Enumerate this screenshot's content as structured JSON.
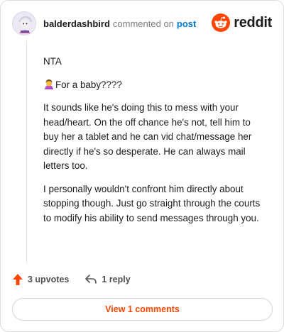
{
  "header": {
    "username": "balderdashbird",
    "action": "commented on",
    "post_link": "post",
    "brand": "reddit"
  },
  "comment": {
    "paragraphs": [
      "NTA",
      "For a baby????",
      "It sounds like he's doing this to mess with your head/heart. On the off chance he's not, tell him to buy her a tablet and he can vid chat/message her directly if he's so desperate. He can always mail letters too.",
      "I personally wouldn't confront him directly about stopping though. Just go straight through the courts to modify his ability to send messages through you."
    ],
    "emoji": "woman-facepalming-emoji"
  },
  "footer": {
    "upvotes": "3 upvotes",
    "replies": "1 reply",
    "view_comments": "View 1 comments"
  },
  "colors": {
    "brand": "#ff4500",
    "link": "#0079d3",
    "upvote": "#ff4500"
  },
  "icons": [
    "avatar",
    "reddit-snoo-icon",
    "upvote-arrow-icon",
    "reply-arrow-icon",
    "woman-facepalming-emoji"
  ]
}
